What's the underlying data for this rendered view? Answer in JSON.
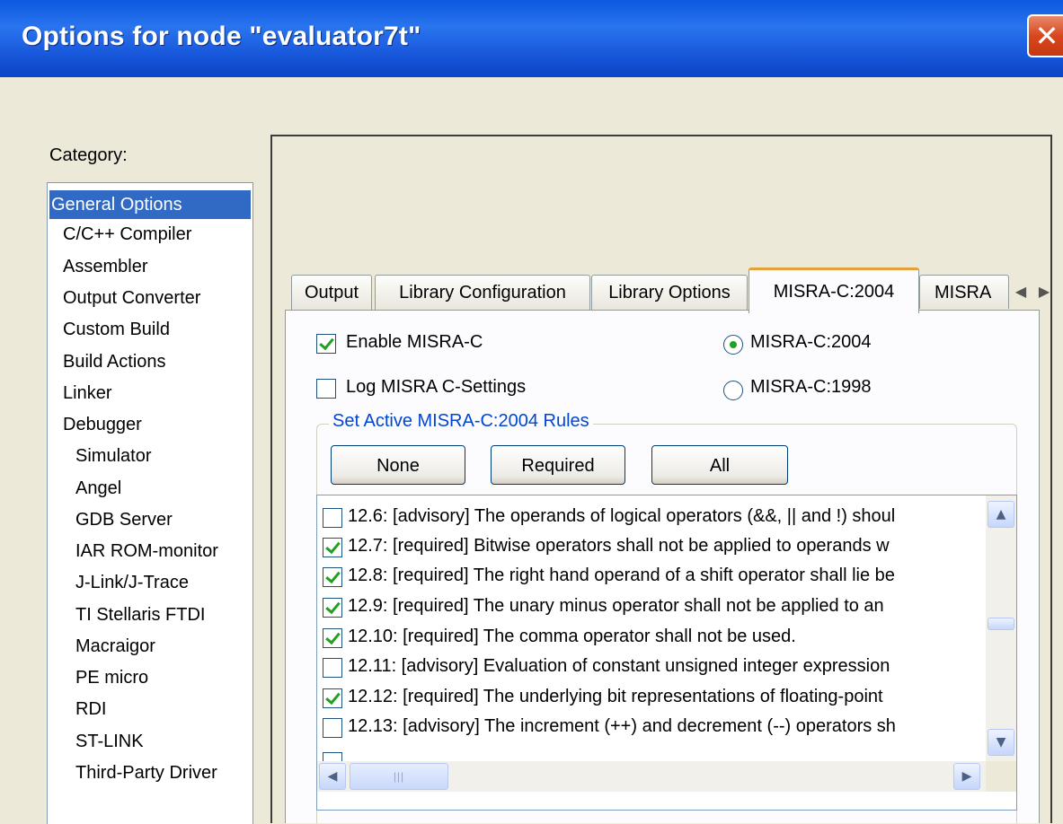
{
  "window": {
    "title": "Options for node \"evaluator7t\"",
    "close_icon": "close-icon"
  },
  "category": {
    "label": "Category:",
    "items": [
      "General Options",
      "C/C++ Compiler",
      "Assembler",
      "Output Converter",
      "Custom Build",
      "Build Actions",
      "Linker",
      "Debugger",
      "Simulator",
      "Angel",
      "GDB Server",
      "IAR ROM-monitor",
      "J-Link/J-Trace",
      "TI Stellaris FTDI",
      "Macraigor",
      "PE micro",
      "RDI",
      "ST-LINK",
      "Third-Party Driver"
    ],
    "selected": "General Options"
  },
  "tabs": [
    {
      "label": "Output"
    },
    {
      "label": "Library Configuration"
    },
    {
      "label": "Library Options"
    },
    {
      "label": "MISRA-C:2004"
    },
    {
      "label": "MISRA"
    }
  ],
  "active_tab": "MISRA-C:2004",
  "misra": {
    "enable_label": "Enable MISRA-C",
    "enable_checked": true,
    "log_label": "Log MISRA C-Settings",
    "log_checked": false,
    "version_2004": "MISRA-C:2004",
    "version_1998": "MISRA-C:1998",
    "selected_version": "MISRA-C:2004",
    "group_title": "Set Active MISRA-C:2004 Rules",
    "buttons": {
      "none": "None",
      "required": "Required",
      "all": "All"
    },
    "rules": [
      {
        "text": "12.6: [advisory] The operands of logical operators (&&, || and !) shoul",
        "checked": false
      },
      {
        "text": "12.7: [required] Bitwise operators shall not be applied to operands w",
        "checked": true
      },
      {
        "text": "12.8: [required] The right hand operand of a shift operator shall lie be",
        "checked": true
      },
      {
        "text": "12.9: [required] The unary minus operator shall not be applied to an",
        "checked": true
      },
      {
        "text": "12.10: [required] The comma operator shall not be used.",
        "checked": true
      },
      {
        "text": "12.11: [advisory] Evaluation of constant unsigned integer expression",
        "checked": false
      },
      {
        "text": "12.12: [required] The underlying bit representations of floating-point",
        "checked": true
      },
      {
        "text": "12.13: [advisory] The increment (++) and decrement (--) operators sh",
        "checked": false
      }
    ],
    "scroll_icons": {
      "up": "▲",
      "down": "▼",
      "left": "◀",
      "right": "▶",
      "grip": "|||"
    }
  }
}
